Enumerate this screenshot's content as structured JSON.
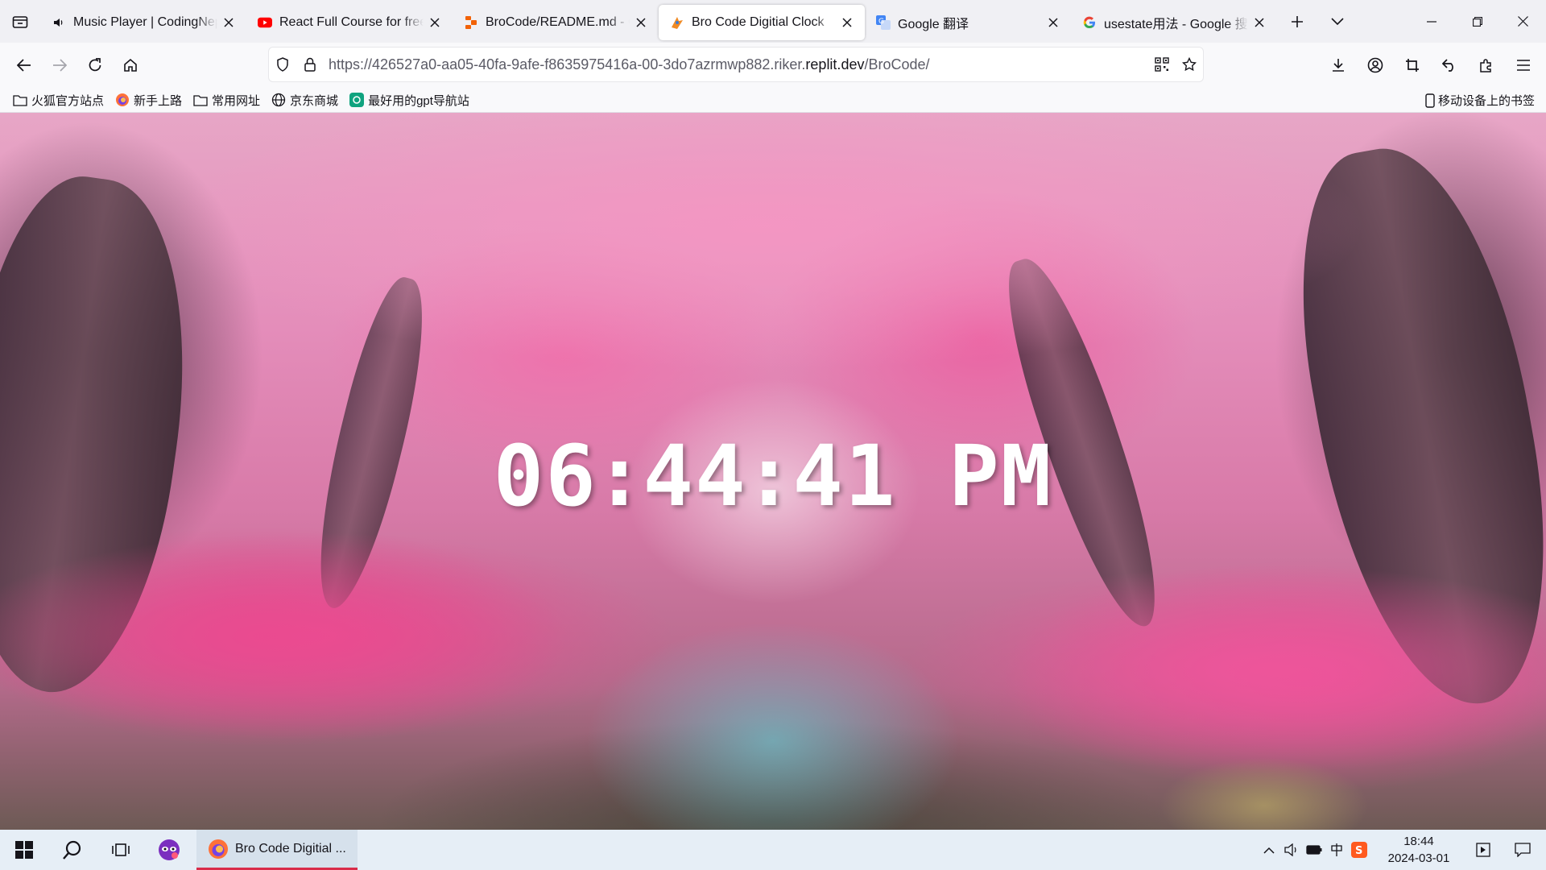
{
  "browser": {
    "tabs": [
      {
        "icon": "speaker-icon",
        "title": "Music Player | CodingNepal",
        "active": false
      },
      {
        "icon": "youtube-icon",
        "title": "React Full Course for free",
        "active": false
      },
      {
        "icon": "replit-icon",
        "title": "BroCode/README.md - CodingNepal",
        "active": false
      },
      {
        "icon": "bro-code-icon",
        "title": "Bro Code Digitial Clock",
        "active": true
      },
      {
        "icon": "google-translate-icon",
        "title": "Google 翻译",
        "active": false
      },
      {
        "icon": "google-icon",
        "title": "usestate用法 - Google 搜索",
        "active": false
      }
    ],
    "url": {
      "prefix": "https://426527a0-aa05-40fa-9afe-f8635975416a-00-3do7azrmwp882.riker.",
      "host": "replit.dev",
      "path": "/BroCode/"
    },
    "bookmarks": [
      {
        "icon": "folder-icon",
        "label": "火狐官方站点"
      },
      {
        "icon": "firefox-icon",
        "label": "新手上路"
      },
      {
        "icon": "folder-icon",
        "label": "常用网址"
      },
      {
        "icon": "globe-icon",
        "label": "京东商城"
      },
      {
        "icon": "chatgpt-icon",
        "label": "最好用的gpt导航站"
      }
    ],
    "mobile_bookmarks": "移动设备上的书签"
  },
  "clock": {
    "hours": "06",
    "minutes": "44",
    "seconds": "41",
    "period": "PM"
  },
  "taskbar": {
    "app_label": "Bro Code Digitial ...",
    "time": "18:44",
    "date": "2024-03-01"
  },
  "colors": {
    "tab_strip": "#f0f0f4",
    "taskbar": "#e6eef6",
    "active_app_underline": "#d92c4a",
    "clock_text": "#ffffff"
  }
}
